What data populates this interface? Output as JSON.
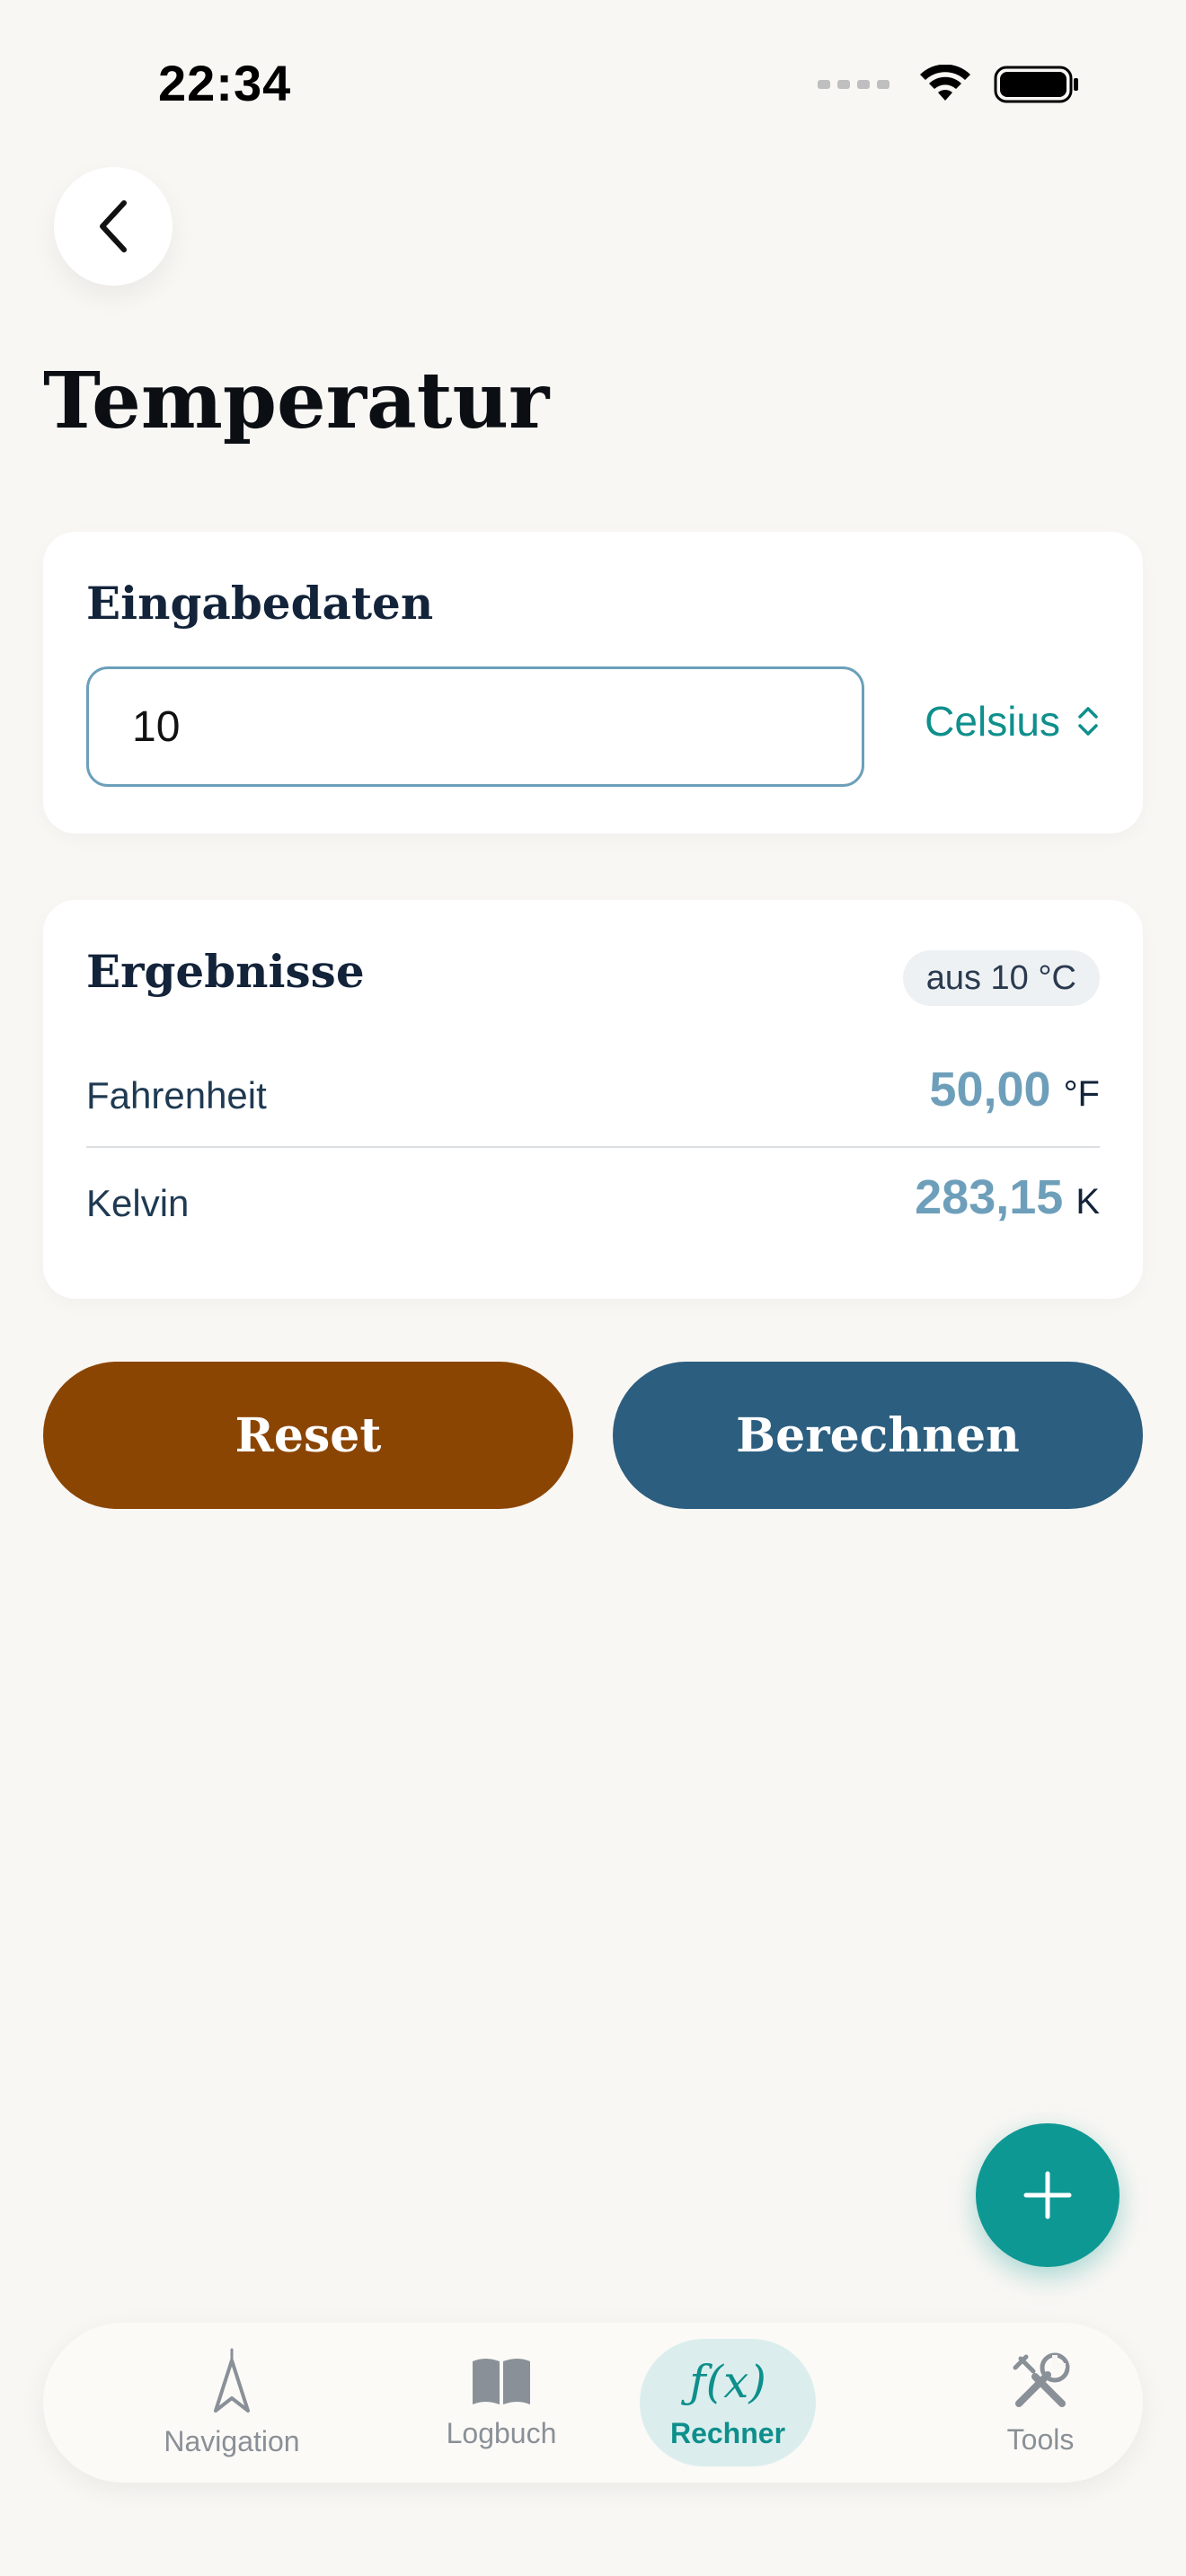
{
  "status": {
    "time": "22:34"
  },
  "page": {
    "title": "Temperatur"
  },
  "input_card": {
    "heading": "Eingabedaten",
    "value": "10",
    "unit": "Celsius"
  },
  "results_card": {
    "heading": "Ergebnisse",
    "badge": "aus 10 °C",
    "rows": [
      {
        "label": "Fahrenheit",
        "value": "50,00",
        "unit": "°F"
      },
      {
        "label": "Kelvin",
        "value": "283,15",
        "unit": "K"
      }
    ]
  },
  "actions": {
    "reset_label": "Reset",
    "calc_label": "Berechnen"
  },
  "tabbar": {
    "items": [
      {
        "label": "Navigation",
        "icon": "navigation-arrow-icon"
      },
      {
        "label": "Logbuch",
        "icon": "book-icon"
      },
      {
        "label": "Rechner",
        "icon": "fx-icon",
        "glyph": "ƒ(x)",
        "active": true
      },
      {
        "label": "Tools",
        "icon": "tools-icon"
      }
    ]
  },
  "colors": {
    "background": "#f9f7f4",
    "accent_teal": "#0e9893",
    "reset_brown": "#8b4503",
    "calc_blue": "#2c5e80",
    "result_blue": "#6e9fba"
  }
}
